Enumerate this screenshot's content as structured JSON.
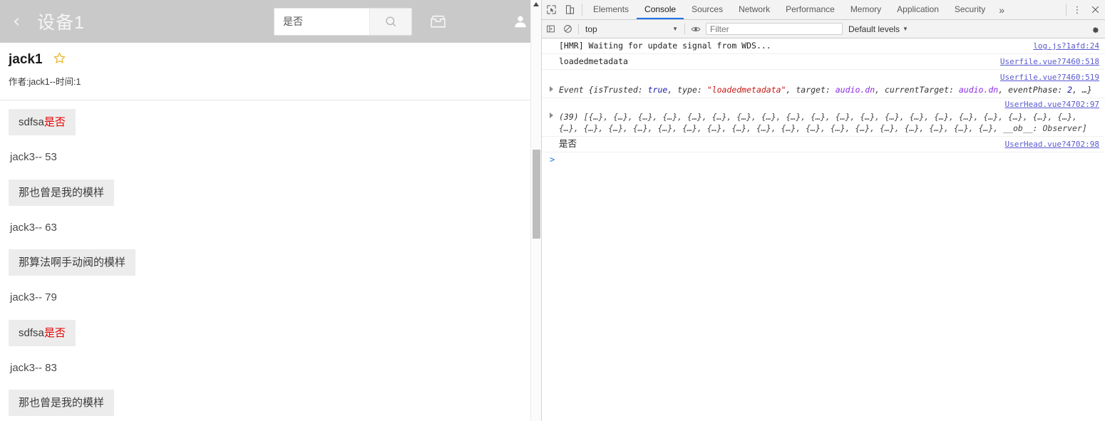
{
  "left_app": {
    "header": {
      "back_icon": "chevron-left-icon",
      "title": "设备1",
      "search_value": "是否",
      "search_placeholder": "",
      "search_icon": "search-icon",
      "inbox_icon": "inbox-icon",
      "avatar_icon": "user-avatar-icon"
    },
    "topic": {
      "name": "jack1",
      "star_icon": "star-icon",
      "meta": "作者:jack1--时间:1"
    },
    "messages": [
      {
        "type": "bubble",
        "text": "sdfsa",
        "highlight": "是否"
      },
      {
        "type": "plain",
        "text": "jack3-- 53"
      },
      {
        "type": "bubble",
        "text": "那也曾是我的模样",
        "highlight": ""
      },
      {
        "type": "plain",
        "text": "jack3-- 63"
      },
      {
        "type": "bubble",
        "text": "那算法啊手动阀的模样",
        "highlight": ""
      },
      {
        "type": "plain",
        "text": "jack3-- 79"
      },
      {
        "type": "bubble",
        "text": "sdfsa",
        "highlight": "是否"
      },
      {
        "type": "plain",
        "text": "jack3-- 83"
      },
      {
        "type": "bubble",
        "text": "那也曾是我的模样",
        "highlight": ""
      }
    ],
    "colors": {
      "header_bg": "#c9c9c9",
      "bubble_bg": "#ececec",
      "highlight": "#e60000",
      "star": "#e8b93a"
    }
  },
  "devtools": {
    "tabbar": {
      "inspect_icon": "inspect-element-icon",
      "device_icon": "device-toolbar-icon",
      "tabs": [
        {
          "label": "Elements",
          "active": false
        },
        {
          "label": "Console",
          "active": true
        },
        {
          "label": "Sources",
          "active": false
        },
        {
          "label": "Network",
          "active": false
        },
        {
          "label": "Performance",
          "active": false
        },
        {
          "label": "Memory",
          "active": false
        },
        {
          "label": "Application",
          "active": false
        },
        {
          "label": "Security",
          "active": false
        }
      ],
      "more_icon": "chevron-double-right-icon",
      "kebab_icon": "more-vertical-icon",
      "close_icon": "close-icon",
      "active_tab_color": "#1a73e8"
    },
    "filterbar": {
      "sidebar_icon": "console-sidebar-icon",
      "clear_icon": "clear-console-icon",
      "context": "top",
      "eye_icon": "live-expression-icon",
      "filter_value": "",
      "filter_placeholder": "Filter",
      "levels_label": "Default levels",
      "settings_icon": "gear-icon"
    },
    "console": {
      "messages": [
        {
          "kind": "text",
          "text": "[HMR] Waiting for update signal from WDS...",
          "source": "log.js?1afd:24"
        },
        {
          "kind": "text",
          "text": "loadedmetadata",
          "source": "Userfile.vue?7460:518"
        },
        {
          "kind": "event",
          "source": "Userfile.vue?7460:519",
          "prefix": "Event {isTrusted: ",
          "t_true": "true",
          "mid1": ", type: ",
          "t_type": "\"loadedmetadata\"",
          "mid2": ", target: ",
          "t_target": "audio.dn",
          "mid3": ", currentTarget: ",
          "t_target2": "audio.dn",
          "mid4": ", eventPhase: ",
          "t_phase": "2",
          "suffix": ", …}"
        },
        {
          "kind": "array",
          "source": "UserHead.vue?4702:97",
          "count_label": "(39)",
          "open_bracket": "[",
          "item": "{…}",
          "items_row1": 20,
          "items_row2": 18,
          "tail": "__ob__: Observer]"
        },
        {
          "kind": "text",
          "text": "是否",
          "source": "UserHead.vue?4702:98",
          "cn": true
        }
      ],
      "prompt": ">"
    }
  }
}
